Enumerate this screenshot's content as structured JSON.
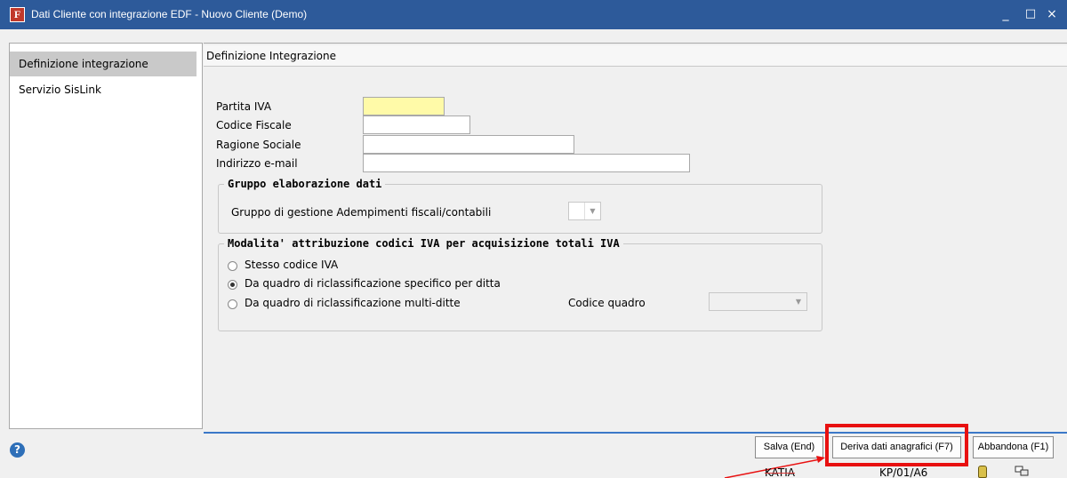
{
  "window": {
    "title": "Dati Cliente con integrazione EDF - Nuovo Cliente  (Demo)",
    "app_icon": "F",
    "minimize": "_",
    "maximize": "□",
    "close": "×"
  },
  "sidebar": {
    "items": [
      {
        "label": "Definizione integrazione",
        "selected": true
      },
      {
        "label": "Servizio SisLink",
        "selected": false
      }
    ]
  },
  "panel": {
    "title": "Definizione Integrazione",
    "fields": {
      "partita_iva": {
        "label": "Partita IVA",
        "value": ""
      },
      "codice_fiscale": {
        "label": "Codice Fiscale",
        "value": ""
      },
      "ragione_sociale": {
        "label": "Ragione Sociale",
        "value": ""
      },
      "email": {
        "label": "Indirizzo e-mail",
        "value": ""
      }
    },
    "group_elab": {
      "title": "Gruppo elaborazione dati",
      "label": "Gruppo di gestione Adempimenti fiscali/contabili",
      "value": ""
    },
    "group_iva": {
      "title": "Modalita' attribuzione codici IVA per acquisizione totali IVA",
      "options": [
        {
          "label": "Stesso codice IVA",
          "checked": false
        },
        {
          "label": "Da quadro di riclassificazione specifico per ditta",
          "checked": true
        },
        {
          "label": "Da quadro di riclassificazione multi-ditte",
          "checked": false
        }
      ],
      "codice_quadro_label": "Codice quadro",
      "codice_quadro_value": ""
    }
  },
  "footer": {
    "help": "?",
    "buttons": {
      "salva": "Salva (End)",
      "deriva": "Deriva dati anagrafici (F7)",
      "abbandona": "Abbandona (F1)"
    },
    "status": {
      "user": "KATIA",
      "code": "KP/01/A6"
    }
  },
  "colors": {
    "titlebar": "#2d5a9a",
    "required_field": "#fffaa8",
    "highlight": "#e81010"
  },
  "icons": [
    "app-logo-icon",
    "minimize-icon",
    "maximize-icon",
    "close-icon",
    "help-icon",
    "dropdown-arrow-icon",
    "database-icon",
    "network-icon"
  ]
}
